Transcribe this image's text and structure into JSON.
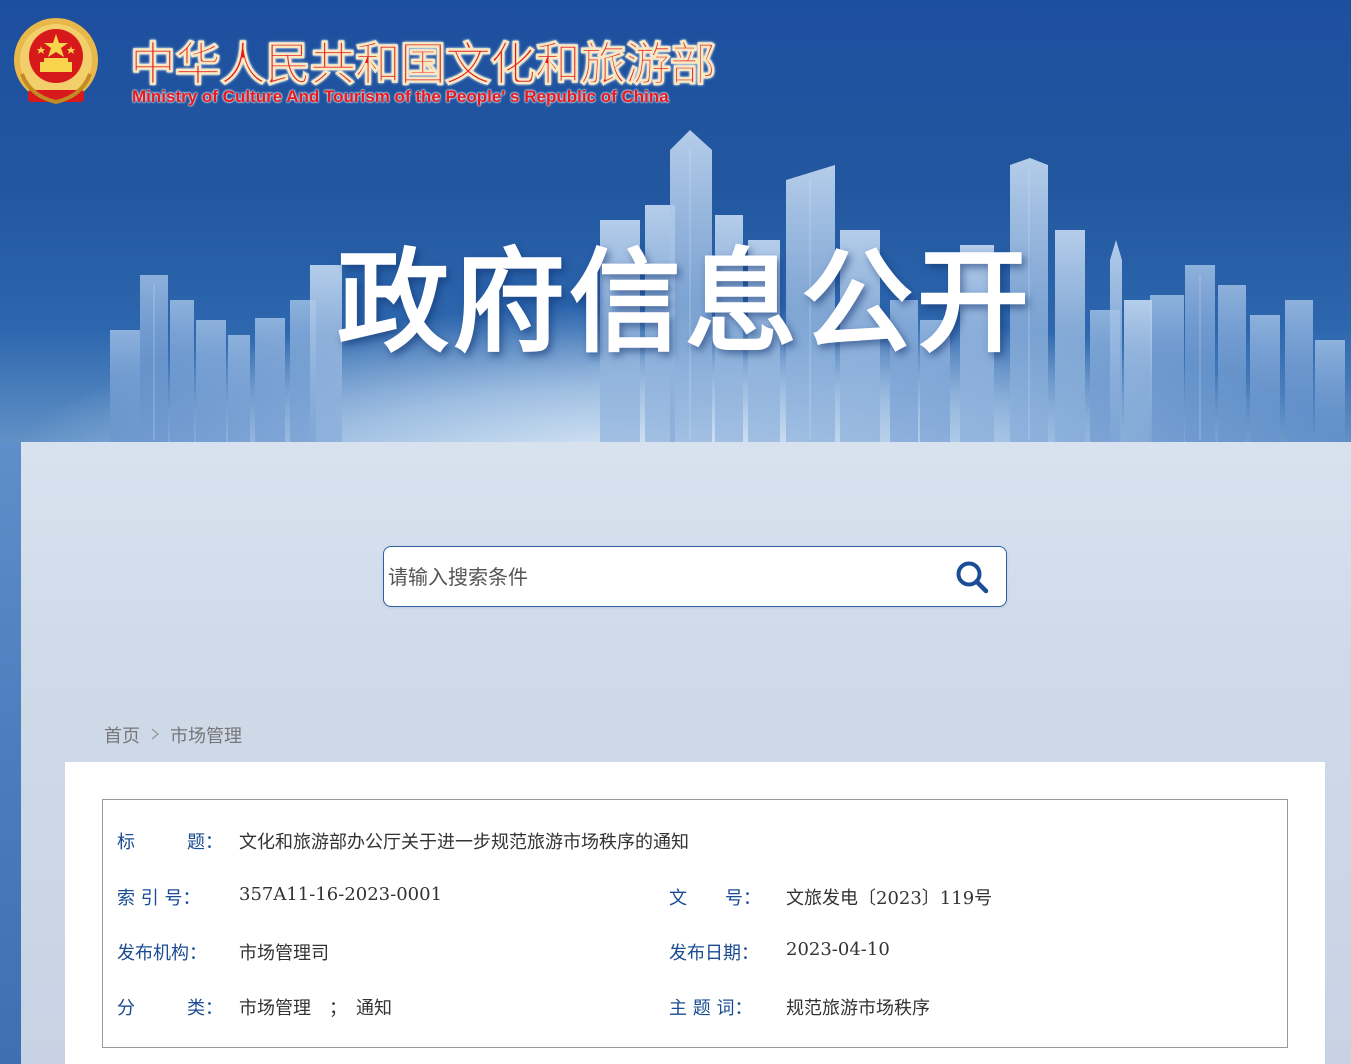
{
  "header": {
    "org_name_cn": "中华人民共和国文化和旅游部",
    "org_name_en": "Ministry of Culture And Tourism of the People' s Republic of China",
    "headline": "政府信息公开",
    "emblem_icon": "national-emblem-icon"
  },
  "search": {
    "placeholder": "请输入搜索条件",
    "icon": "search-icon"
  },
  "breadcrumb": {
    "home": "首页",
    "separator": ">",
    "current": "市场管理"
  },
  "document_meta": {
    "title_label_chars": [
      "标",
      "题"
    ],
    "title_colon": "：",
    "title_value": "文化和旅游部办公厅关于进一步规范旅游市场秩序的通知",
    "index_label": "索 引 号：",
    "index_value": "357A11-16-2023-0001",
    "docnum_label_chars": [
      "文",
      "号"
    ],
    "docnum_colon": "：",
    "docnum_value": "文旅发电〔2023〕119号",
    "publisher_label": "发布机构：",
    "publisher_value": "市场管理司",
    "date_label": "发布日期：",
    "date_value": "2023-04-10",
    "category_label_chars": [
      "分",
      "类"
    ],
    "category_colon": "：",
    "category_value": "市场管理　；　通知",
    "keywords_label": "主 题 词：",
    "keywords_value": "规范旅游市场秩序"
  },
  "colors": {
    "label_blue": "#1a4b93",
    "brand_red": "#e5181d",
    "banner_blue": "#1d4f9f"
  }
}
